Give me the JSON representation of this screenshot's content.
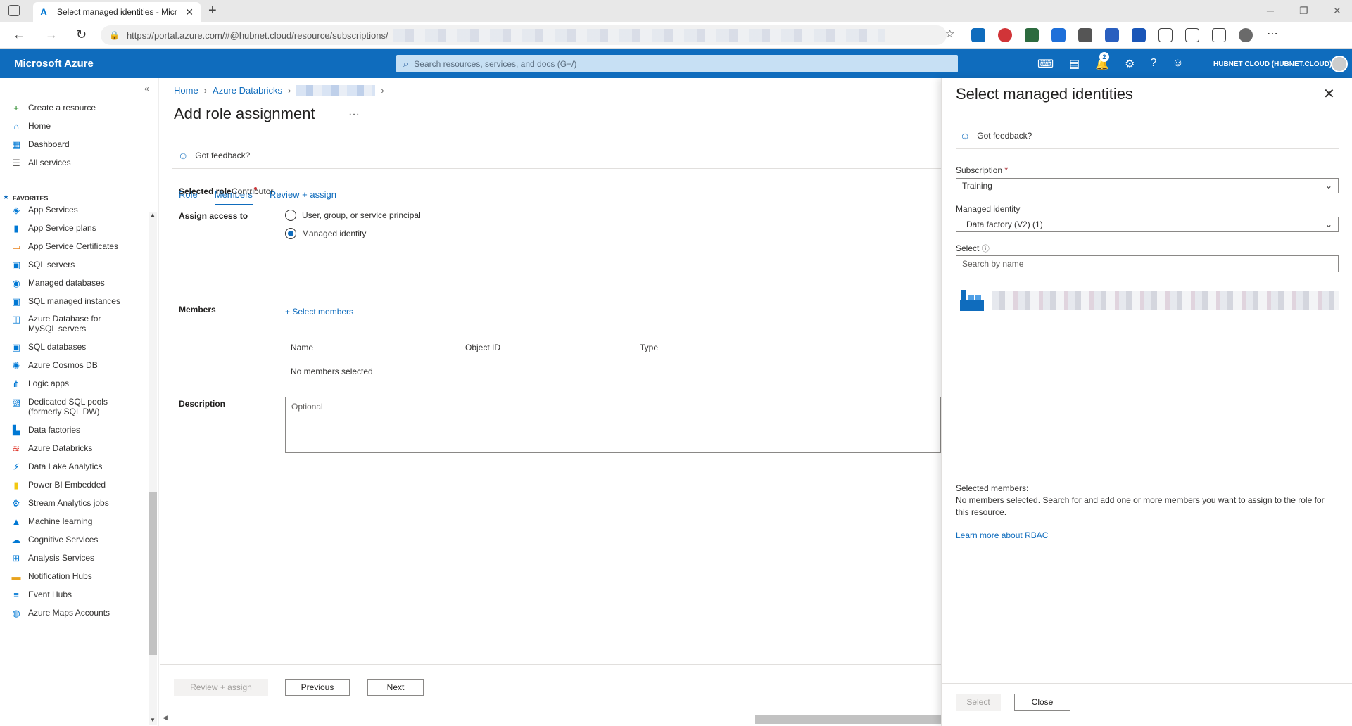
{
  "browser": {
    "tab_title": "Select managed identities - Micr",
    "url": "https://portal.azure.com/#@hubnet.cloud/resource/subscriptions/"
  },
  "topbar": {
    "brand": "Microsoft Azure",
    "search_placeholder": "Search resources, services, and docs (G+/)",
    "notification_count": "2",
    "tenant": "HUBNET CLOUD (HUBNET.CLOUD)"
  },
  "sidebar": {
    "items": [
      {
        "label": "Create a resource",
        "icon": "plus-icon",
        "color": "#107c10"
      },
      {
        "label": "Home",
        "icon": "home-icon",
        "color": "#0078d4"
      },
      {
        "label": "Dashboard",
        "icon": "dashboard-icon",
        "color": "#0078d4"
      },
      {
        "label": "All services",
        "icon": "list-icon",
        "color": "#605e5c"
      }
    ],
    "favorites_label": "FAVORITES",
    "favorites": [
      {
        "label": "App Services",
        "icon": "app-services-icon",
        "color": "#0078d4"
      },
      {
        "label": "App Service plans",
        "icon": "app-service-plans-icon",
        "color": "#0078d4"
      },
      {
        "label": "App Service Certificates",
        "icon": "certificate-icon",
        "color": "#e8831e"
      },
      {
        "label": "SQL servers",
        "icon": "sql-server-icon",
        "color": "#0078d4"
      },
      {
        "label": "Managed databases",
        "icon": "managed-database-icon",
        "color": "#0078d4"
      },
      {
        "label": "SQL managed instances",
        "icon": "sql-managed-instance-icon",
        "color": "#0078d4"
      },
      {
        "label": "Azure Database for",
        "label2": "MySQL servers",
        "icon": "mysql-icon",
        "color": "#0078d4"
      },
      {
        "label": "SQL databases",
        "icon": "sql-database-icon",
        "color": "#0078d4"
      },
      {
        "label": "Azure Cosmos DB",
        "icon": "cosmos-db-icon",
        "color": "#0078d4"
      },
      {
        "label": "Logic apps",
        "icon": "logic-apps-icon",
        "color": "#0078d4"
      },
      {
        "label": "Dedicated SQL pools",
        "label2": "(formerly SQL DW)",
        "icon": "sql-pool-icon",
        "color": "#0078d4"
      },
      {
        "label": "Data factories",
        "icon": "data-factory-icon",
        "color": "#0078d4"
      },
      {
        "label": "Azure Databricks",
        "icon": "databricks-icon",
        "color": "#e03c31"
      },
      {
        "label": "Data Lake Analytics",
        "icon": "data-lake-icon",
        "color": "#0078d4"
      },
      {
        "label": "Power BI Embedded",
        "icon": "power-bi-icon",
        "color": "#f2c811"
      },
      {
        "label": "Stream Analytics jobs",
        "icon": "stream-analytics-icon",
        "color": "#0078d4"
      },
      {
        "label": "Machine learning",
        "icon": "machine-learning-icon",
        "color": "#0078d4"
      },
      {
        "label": "Cognitive Services",
        "icon": "cognitive-services-icon",
        "color": "#0078d4"
      },
      {
        "label": "Analysis Services",
        "icon": "analysis-services-icon",
        "color": "#0078d4"
      },
      {
        "label": "Notification Hubs",
        "icon": "notification-hubs-icon",
        "color": "#e8a31e"
      },
      {
        "label": "Event Hubs",
        "icon": "event-hubs-icon",
        "color": "#0078d4"
      },
      {
        "label": "Azure Maps Accounts",
        "icon": "maps-icon",
        "color": "#0078d4"
      }
    ]
  },
  "main": {
    "breadcrumb": [
      "Home",
      "Azure Databricks"
    ],
    "title": "Add role assignment",
    "feedback": "Got feedback?",
    "tabs": [
      "Role",
      "Members",
      "Review + assign"
    ],
    "selected_role_label": "Selected role",
    "selected_role_value": "Contributor",
    "assign_access_label": "Assign access to",
    "radio_user": "User, group, or service principal",
    "radio_managed": "Managed identity",
    "members_label": "Members",
    "select_members": "+ Select members",
    "table_headers": [
      "Name",
      "Object ID",
      "Type"
    ],
    "table_empty": "No members selected",
    "description_label": "Description",
    "description_placeholder": "Optional",
    "btn_review": "Review + assign",
    "btn_previous": "Previous",
    "btn_next": "Next"
  },
  "blade": {
    "title": "Select managed identities",
    "feedback": "Got feedback?",
    "subscription_label": "Subscription",
    "subscription_value": "Training",
    "managed_identity_label": "Managed identity",
    "managed_identity_value": "Data factory (V2) (1)",
    "select_label": "Select",
    "search_placeholder": "Search by name",
    "selected_members_title": "Selected members:",
    "selected_members_text": "No members selected. Search for and add one or more members you want to assign to the role for this resource.",
    "learn_more": "Learn more about RBAC",
    "btn_select": "Select",
    "btn_close": "Close"
  }
}
